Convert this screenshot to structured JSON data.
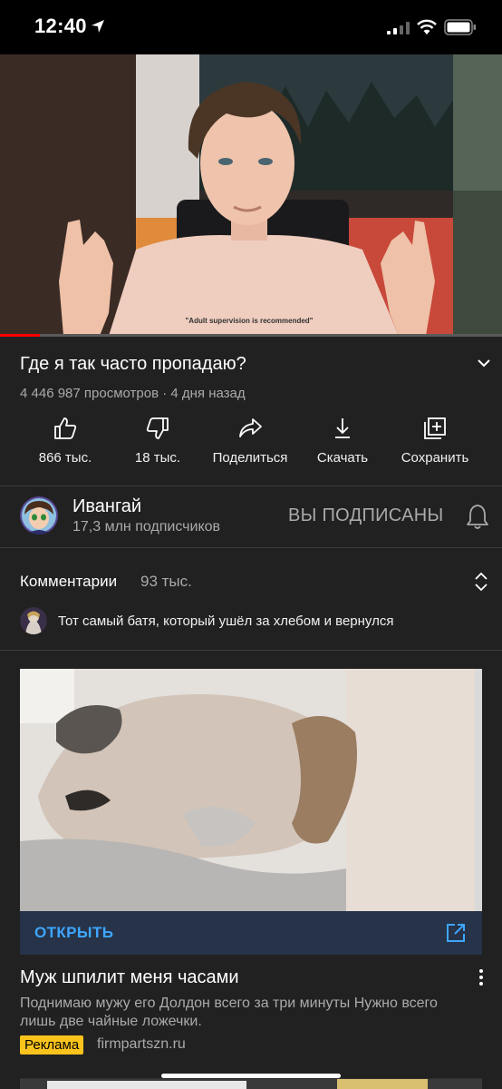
{
  "status_bar": {
    "time": "12:40"
  },
  "video": {
    "shirt_text": "\"Adult supervision is recommended\"",
    "progress_percent": 8,
    "title": "Где я так часто пропадаю?",
    "meta": "4 446 987 просмотров · 4 дня назад"
  },
  "actions": [
    {
      "label": "866 тыс.",
      "icon": "thumbs-up-icon"
    },
    {
      "label": "18 тыс.",
      "icon": "thumbs-down-icon"
    },
    {
      "label": "Поделиться",
      "icon": "share-icon"
    },
    {
      "label": "Скачать",
      "icon": "download-icon"
    },
    {
      "label": "Сохранить",
      "icon": "save-to-playlist-icon"
    }
  ],
  "channel": {
    "name": "Ивангай",
    "subscribers": "17,3 млн подписчиков",
    "subscribe_state": "ВЫ ПОДПИСАНЫ"
  },
  "comments": {
    "label": "Комментарии",
    "count": "93 тыс.",
    "top_comment": "Тот самый батя, который ушёл за хлебом и вернулся"
  },
  "ad": {
    "open_label": "ОТКРЫТЬ",
    "title": "Муж шпилит меня часами",
    "description": "Поднимаю мужу его Долдон всего за три минуты Нужно всего лишь две чайные ложечки.",
    "badge": "Реклама",
    "domain": "firmpartszn.ru"
  },
  "colors": {
    "background": "#212121",
    "accent_blue": "#3ea6ff",
    "ad_badge": "#f9c31c",
    "progress_red": "#ff0000"
  }
}
